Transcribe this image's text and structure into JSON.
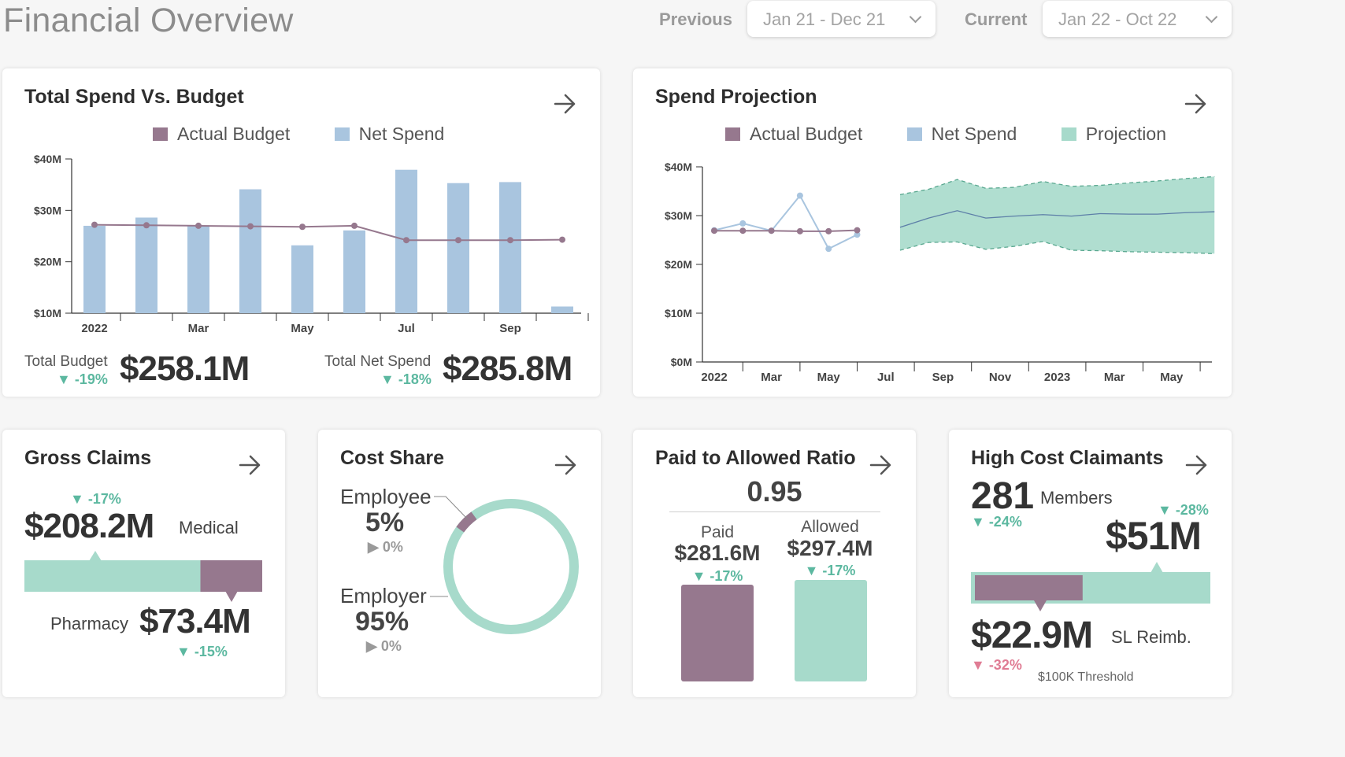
{
  "header": {
    "title": "Financial Overview",
    "previous_label": "Previous",
    "previous_value": "Jan 21 - Dec 21",
    "current_label": "Current",
    "current_value": "Jan 22 - Oct 22"
  },
  "colors": {
    "budget": "#96788e",
    "net_spend": "#a9c5df",
    "projection": "#a7dacb",
    "positive": "#5cb8a0",
    "negative": "#e07c94"
  },
  "spend_budget": {
    "title": "Total Spend Vs. Budget",
    "legend": [
      "Actual Budget",
      "Net Spend"
    ],
    "total_budget_label": "Total Budget",
    "total_budget_change": "▼ -19%",
    "total_budget_value": "$258.1M",
    "total_net_label": "Total Net Spend",
    "total_net_change": "▼ -18%",
    "total_net_value": "$285.8M"
  },
  "projection": {
    "title": "Spend Projection",
    "legend": [
      "Actual Budget",
      "Net Spend",
      "Projection"
    ]
  },
  "chart_data": [
    {
      "type": "bar",
      "title": "Total Spend Vs. Budget",
      "x": [
        "2022-01",
        "2022-02",
        "2022-03",
        "2022-04",
        "2022-05",
        "2022-06",
        "2022-07",
        "2022-08",
        "2022-09",
        "2022-10"
      ],
      "tick_labels": [
        "2022",
        "Mar",
        "May",
        "Jul",
        "Sep"
      ],
      "ylim": [
        10,
        40
      ],
      "yticks": [
        "$10M",
        "$20M",
        "$30M",
        "$40M"
      ],
      "series": [
        {
          "name": "Net Spend",
          "type": "bar",
          "values": [
            27.0,
            28.6,
            27.0,
            34.1,
            23.2,
            26.1,
            37.9,
            35.3,
            35.5,
            11.3
          ]
        },
        {
          "name": "Actual Budget",
          "type": "line",
          "values": [
            27.2,
            27.1,
            27.0,
            26.9,
            26.8,
            27.0,
            24.2,
            24.2,
            24.2,
            24.3
          ]
        }
      ],
      "legend": "top"
    },
    {
      "type": "line",
      "title": "Spend Projection",
      "ylim": [
        0,
        40
      ],
      "yticks": [
        "$0M",
        "$10M",
        "$20M",
        "$30M",
        "$40M"
      ],
      "tick_labels": [
        "2022",
        "Mar",
        "May",
        "Jul",
        "Sep",
        "Nov",
        "2023",
        "Mar",
        "May"
      ],
      "series": [
        {
          "name": "Actual Budget",
          "x": [
            "2022-01",
            "2022-02",
            "2022-03",
            "2022-04",
            "2022-05",
            "2022-06"
          ],
          "values": [
            26.9,
            26.9,
            26.9,
            26.8,
            26.8,
            27.0
          ]
        },
        {
          "name": "Net Spend",
          "x": [
            "2022-01",
            "2022-02",
            "2022-03",
            "2022-04",
            "2022-05",
            "2022-06"
          ],
          "values": [
            27.0,
            28.4,
            26.9,
            34.1,
            23.2,
            26.1
          ]
        },
        {
          "name": "Projection",
          "x": [
            "2022-07",
            "2022-08",
            "2022-09",
            "2022-10",
            "2022-11",
            "2022-12",
            "2023-01",
            "2023-02",
            "2023-03",
            "2023-04",
            "2023-05",
            "2023-06"
          ],
          "values": [
            27.6,
            29.5,
            31.0,
            29.5,
            29.9,
            30.2,
            29.9,
            30.4,
            30.3,
            30.3,
            30.6,
            30.8
          ],
          "upper": [
            34.3,
            35.4,
            37.4,
            35.6,
            35.8,
            37.0,
            36.0,
            36.2,
            36.7,
            37.1,
            37.6,
            38.0
          ],
          "lower": [
            22.9,
            24.5,
            24.6,
            23.1,
            23.7,
            24.7,
            22.9,
            22.8,
            22.6,
            22.5,
            22.4,
            22.2
          ]
        }
      ],
      "legend": "top"
    }
  ],
  "gross_claims": {
    "title": "Gross Claims",
    "medical_change": "▼ -17%",
    "medical_value": "$208.2M",
    "medical_label": "Medical",
    "pharmacy_label": "Pharmacy",
    "pharmacy_value": "$73.4M",
    "pharmacy_change": "▼ -15%",
    "medical_share": 0.74
  },
  "cost_share": {
    "title": "Cost Share",
    "employee_label": "Employee",
    "employee_pct": "5%",
    "employee_change": "▶ 0%",
    "employer_label": "Employer",
    "employer_pct": "95%",
    "employer_change": "▶ 0%",
    "employee_fraction": 0.05
  },
  "paid_allowed": {
    "title": "Paid to Allowed Ratio",
    "ratio": "0.95",
    "paid_label": "Paid",
    "paid_value": "$281.6M",
    "paid_change": "▼ -17%",
    "allowed_label": "Allowed",
    "allowed_value": "$297.4M",
    "allowed_change": "▼ -17%"
  },
  "high_cost": {
    "title": "High Cost Claimants",
    "members_count": "281",
    "members_label": "Members",
    "members_change": "▼ -24%",
    "cost_change": "▼ -28%",
    "cost_value": "$51M",
    "reimb_value": "$22.9M",
    "reimb_label": "SL Reimb.",
    "reimb_change": "▼ -32%",
    "threshold": "$100K Threshold",
    "reimb_share": 0.45
  }
}
